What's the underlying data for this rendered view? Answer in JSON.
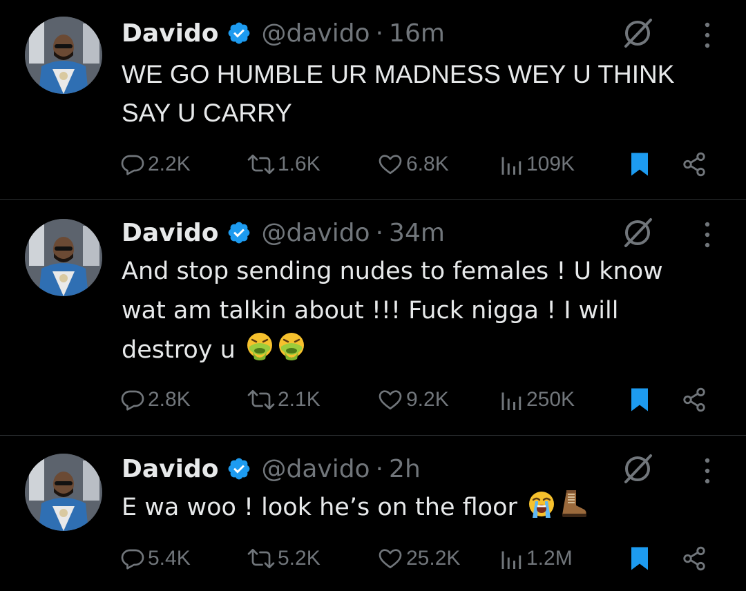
{
  "colors": {
    "background": "#000000",
    "text": "#e7e9ea",
    "muted": "#71767b",
    "verified": "#1d9bf0",
    "bookmark": "#1d9bf0",
    "divider": "#2f3336"
  },
  "tweets": [
    {
      "author": "Davido",
      "handle": "@davido",
      "separator": "·",
      "time": "16m",
      "text": "WE GO HUMBLE UR MADNESS WEY U THINK\nSAY U CARRY",
      "emojis": [],
      "replies": "2.2K",
      "reposts": "1.6K",
      "likes": "6.8K",
      "views": "109K",
      "bookmarked": true
    },
    {
      "author": "Davido",
      "handle": "@davido",
      "separator": "·",
      "time": "34m",
      "text": "And stop sending nudes to females ! U know\nwat am talkin about !!! Fuck nigga ! I will\ndestroy u ",
      "emojis": [
        "vomiting-face-emoji",
        "vomiting-face-emoji"
      ],
      "replies": "2.8K",
      "reposts": "2.1K",
      "likes": "9.2K",
      "views": "250K",
      "bookmarked": true
    },
    {
      "author": "Davido",
      "handle": "@davido",
      "separator": "·",
      "time": "2h",
      "text": "E wa woo ! look he’s on the floor ",
      "emojis": [
        "loudly-crying-face-emoji",
        "boot-emoji"
      ],
      "replies": "5.4K",
      "reposts": "5.2K",
      "likes": "25.2K",
      "views": "1.2M",
      "bookmarked": true
    }
  ],
  "icons": {
    "reply": "speech-bubble-icon",
    "repost": "repost-arrows-icon",
    "like": "heart-outline-icon",
    "views": "bar-chart-icon",
    "bookmark": "bookmark-filled-icon",
    "share": "share-nodes-icon",
    "grok": "grok-slash-icon",
    "more": "vertical-dots-icon",
    "verified": "verified-badge-icon"
  }
}
